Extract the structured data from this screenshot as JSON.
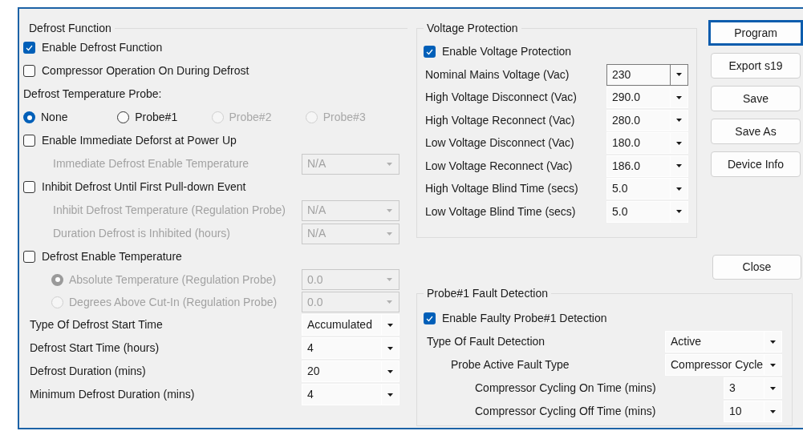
{
  "defrost": {
    "title": "Defrost Function",
    "items": [
      {
        "kind": "checkbox",
        "label": "Enable Defrost Function",
        "checked": true
      },
      {
        "kind": "checkbox",
        "label": "Compressor Operation On During Defrost",
        "checked": false
      },
      {
        "kind": "heading",
        "label": "Defrost Temperature Probe:"
      },
      {
        "kind": "radios",
        "options": [
          {
            "label": "None",
            "selected": true,
            "disabled": false
          },
          {
            "label": "Probe#1",
            "selected": false,
            "disabled": false
          },
          {
            "label": "Probe#2",
            "selected": false,
            "disabled": true
          },
          {
            "label": "Probe#3",
            "selected": false,
            "disabled": true
          }
        ]
      },
      {
        "kind": "checkbox",
        "label": "Enable Immediate Deforst at Power Up",
        "checked": false,
        "children": [
          {
            "kind": "field",
            "label": "Immediate Defrost Enable Temperature",
            "value": "N/A",
            "disabled": true
          }
        ]
      },
      {
        "kind": "checkbox",
        "label": "Inhibit Defrost Until First Pull-down Event",
        "checked": false,
        "children": [
          {
            "kind": "field",
            "label": "Inhibit Defrost Temperature (Regulation Probe)",
            "value": "N/A",
            "disabled": true
          },
          {
            "kind": "field",
            "label": "Duration Defrost is Inhibited (hours)",
            "value": "N/A",
            "disabled": true
          }
        ]
      },
      {
        "kind": "checkbox",
        "label": "Defrost Enable Temperature",
        "checked": false,
        "children": [
          {
            "kind": "radio_field",
            "label": "Absolute Temperature (Regulation Probe)",
            "value": "0.0",
            "selected": true,
            "disabled": true
          },
          {
            "kind": "radio_field",
            "label": "Degrees Above Cut-In (Regulation Probe)",
            "value": "0.0",
            "selected": false,
            "disabled": true
          }
        ]
      },
      {
        "kind": "field",
        "label": "Type Of Defrost Start Time",
        "value": "Accumulated",
        "disabled": false
      },
      {
        "kind": "field",
        "label": "Defrost Start Time (hours)",
        "value": "4",
        "disabled": false
      },
      {
        "kind": "field",
        "label": "Defrost Duration (mins)",
        "value": "20",
        "disabled": false
      },
      {
        "kind": "field",
        "label": "Minimum Defrost Duration (mins)",
        "value": "4",
        "disabled": false
      }
    ]
  },
  "voltage": {
    "title": "Voltage Protection",
    "enable": {
      "label": "Enable Voltage Protection",
      "checked": true
    },
    "fields": [
      {
        "label": "Nominal Mains Voltage (Vac)",
        "value": "230",
        "focused": true
      },
      {
        "label": "High Voltage Disconnect (Vac)",
        "value": "290.0",
        "focused": false
      },
      {
        "label": "High Voltage Reconnect (Vac)",
        "value": "280.0",
        "focused": false
      },
      {
        "label": "Low Voltage Disconnect (Vac)",
        "value": "180.0",
        "focused": false
      },
      {
        "label": "Low Voltage Reconnect (Vac)",
        "value": "186.0",
        "focused": false
      },
      {
        "label": "High Voltage Blind Time (secs)",
        "value": "5.0",
        "focused": false
      },
      {
        "label": "Low Voltage Blind Time (secs)",
        "value": "5.0",
        "focused": false
      }
    ]
  },
  "buttons": [
    {
      "label": "Program",
      "default": true
    },
    {
      "label": "Export s19",
      "default": false
    },
    {
      "label": "Save",
      "default": false
    },
    {
      "label": "Save As",
      "default": false
    },
    {
      "label": "Device Info",
      "default": false
    }
  ],
  "close_button": {
    "label": "Close"
  },
  "probe_fault": {
    "title": "Probe#1 Fault Detection",
    "enable": {
      "label": "Enable Faulty Probe#1 Detection",
      "checked": true
    },
    "fields": [
      {
        "label": "Type Of Fault Detection",
        "value": "Active",
        "children": [
          {
            "label": "Probe Active Fault Type",
            "value": "Compressor Cycle",
            "children": [
              {
                "label": "Compressor Cycling On Time (mins)",
                "value": "3"
              },
              {
                "label": "Compressor Cycling Off Time (mins)",
                "value": "10"
              }
            ]
          }
        ]
      }
    ]
  }
}
